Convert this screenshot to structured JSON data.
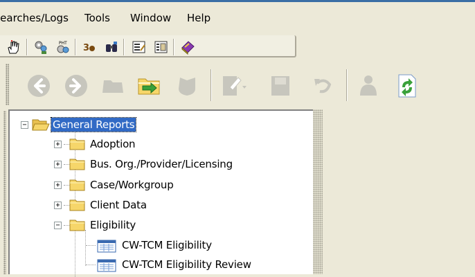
{
  "menu": [
    {
      "id": "searches_logs",
      "label": "iearches/Logs"
    },
    {
      "id": "tools",
      "label": "Tools"
    },
    {
      "id": "window",
      "label": "Window"
    },
    {
      "id": "help",
      "label": "Help"
    }
  ],
  "toolbar_small": {
    "buttons": [
      "hand-pointer-icon",
      "gear-people-icon",
      "pht-icon",
      "3d-icon",
      "binoculars-icon",
      "form-edit-icon",
      "form-list-icon",
      "book-icon"
    ]
  },
  "toolbar_large": {
    "buttons": [
      {
        "icon": "back-arrow-icon",
        "enabled": false
      },
      {
        "icon": "forward-arrow-icon",
        "enabled": false
      },
      {
        "icon": "open-folder-icon",
        "enabled": false
      },
      {
        "icon": "import-folder-icon",
        "enabled": true
      },
      {
        "icon": "shield-icon",
        "enabled": false
      },
      {
        "icon": "edit-document-icon",
        "enabled": false
      },
      {
        "icon": "save-icon",
        "enabled": false
      },
      {
        "icon": "undo-icon",
        "enabled": false
      },
      {
        "icon": "person-icon",
        "enabled": false
      },
      {
        "icon": "refresh-icon",
        "enabled": true
      }
    ]
  },
  "tree": {
    "root": {
      "label": "General Reports",
      "expanded": true,
      "selected": true
    },
    "folders": [
      {
        "label": "Adoption",
        "expanded": false
      },
      {
        "label": "Bus. Org./Provider/Licensing",
        "expanded": false
      },
      {
        "label": "Case/Workgroup",
        "expanded": false
      },
      {
        "label": "Client Data",
        "expanded": false
      },
      {
        "label": "Eligibility",
        "expanded": true
      }
    ],
    "reports": [
      {
        "label": "CW-TCM Eligibility"
      },
      {
        "label": "CW-TCM Eligibility Review"
      }
    ]
  },
  "colors": {
    "selection": "#316ac5",
    "folder": "#f6d66a",
    "refresh_green": "#3aa13a"
  }
}
